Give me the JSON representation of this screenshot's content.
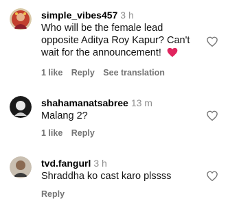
{
  "colors": {
    "muted": "#8e8e8e",
    "actions": "#737373",
    "red_heart": "#e0245e"
  },
  "comments": [
    {
      "username": "simple_vibes457",
      "time": "3 h",
      "text": "Who will be the female lead opposite Aditya Roy Kapur? Can't wait for the announcement!",
      "has_heart_emoji": true,
      "likes": "1 like",
      "reply": "Reply",
      "see_translation": "See translation"
    },
    {
      "username": "shahamanatsabree",
      "time": "13 m",
      "text": "Malang 2?",
      "likes": "1 like",
      "reply": "Reply"
    },
    {
      "username": "tvd.fangurl",
      "time": "3 h",
      "text": "Shraddha ko cast karo plssss",
      "reply": "Reply"
    }
  ],
  "icons": {
    "like": "heart-outline-icon",
    "emoji": "red-heart-emoji"
  }
}
